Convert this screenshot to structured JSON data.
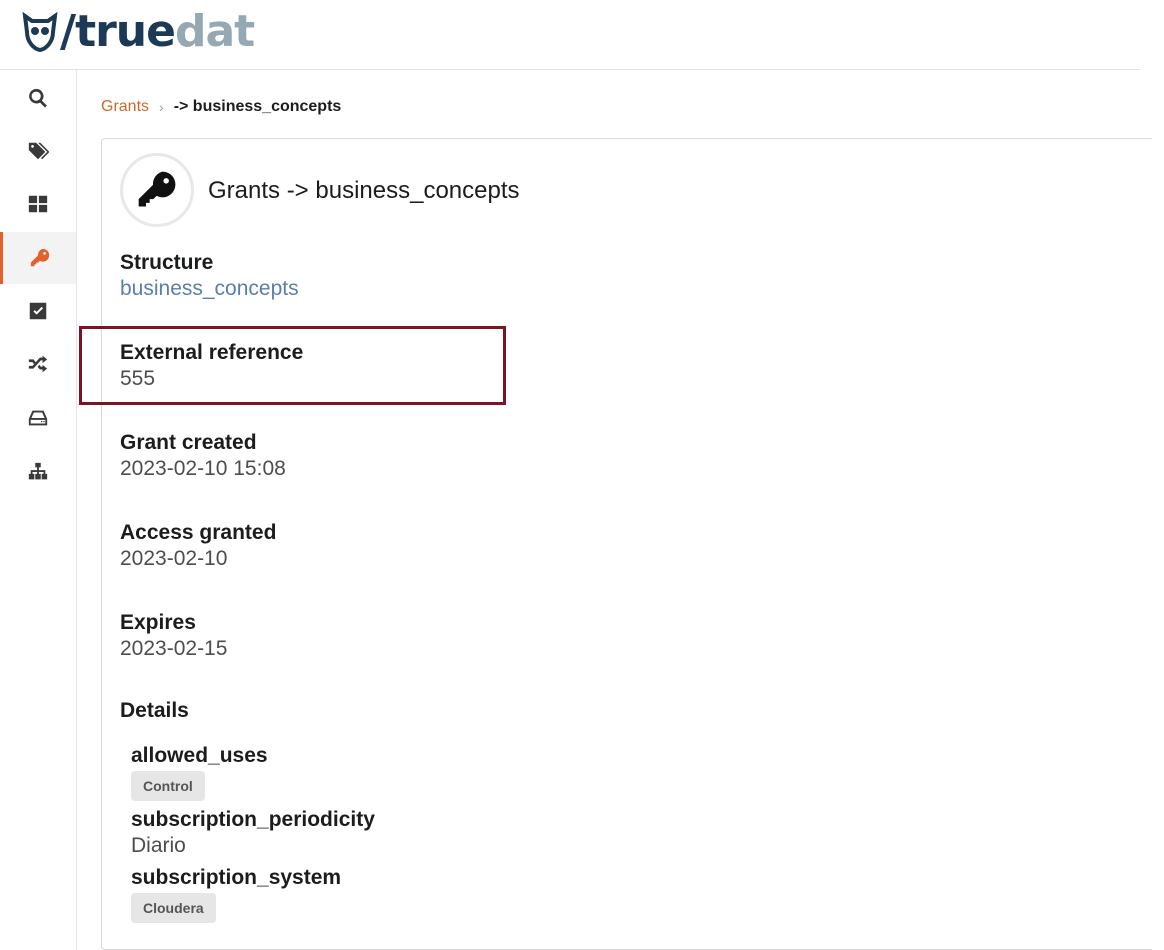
{
  "logo": {
    "slash": "/",
    "word1": "true",
    "word2": "dat"
  },
  "sidebar": {
    "items": [
      {
        "icon": "search-icon"
      },
      {
        "icon": "tags-icon"
      },
      {
        "icon": "dashboard-icon"
      },
      {
        "icon": "key-icon",
        "active": true
      },
      {
        "icon": "check-square-icon"
      },
      {
        "icon": "shuffle-icon"
      },
      {
        "icon": "drive-icon"
      },
      {
        "icon": "sitemap-icon"
      }
    ]
  },
  "breadcrumb": {
    "link": "Grants",
    "divider": "›",
    "current": "-> business_concepts"
  },
  "header": {
    "title": "Grants -> business_concepts",
    "icon": "key-icon"
  },
  "fields": {
    "structure": {
      "label": "Structure",
      "value": "business_concepts"
    },
    "external_reference": {
      "label": "External reference",
      "value": "555"
    },
    "grant_created": {
      "label": "Grant created",
      "value": "2023-02-10 15:08"
    },
    "access_granted": {
      "label": "Access granted",
      "value": "2023-02-10"
    },
    "expires": {
      "label": "Expires",
      "value": "2023-02-15"
    }
  },
  "details": {
    "title": "Details",
    "allowed_uses": {
      "key": "allowed_uses",
      "tag": "Control"
    },
    "subscription_periodicity": {
      "key": "subscription_periodicity",
      "value": "Diario"
    },
    "subscription_system": {
      "key": "subscription_system",
      "tag": "Cloudera"
    }
  },
  "colors": {
    "accent": "#e2622b",
    "link": "#5a7faa",
    "highlight_border": "#7a1526",
    "brand_dark": "#1c3a56",
    "brand_light": "#95a9b5"
  }
}
